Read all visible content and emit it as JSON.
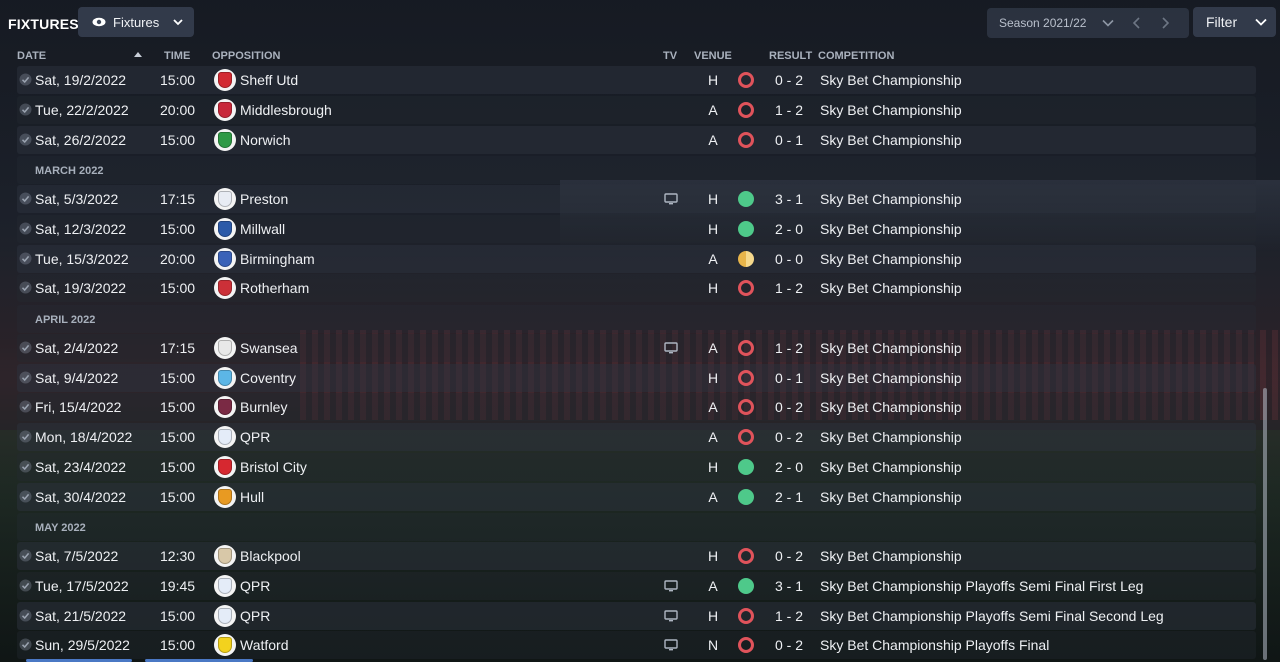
{
  "header": {
    "title": "FIXTURES",
    "view_label": "Fixtures",
    "season_label": "Season 2021/22",
    "filter_label": "Filter"
  },
  "columns": {
    "date": "DATE",
    "time": "TIME",
    "opposition": "OPPOSITION",
    "tv": "TV",
    "venue": "VENUE",
    "result": "RESULT",
    "competition": "COMPETITION"
  },
  "months": [
    "MARCH 2022",
    "APRIL 2022",
    "MAY 2022"
  ],
  "fixtures": [
    {
      "date": "Sat, 19/2/2022",
      "time": "15:00",
      "opponent": "Sheff Utd",
      "crest_color": "#d22a32",
      "tv": false,
      "venue": "H",
      "result": "loss",
      "score": "0 - 2",
      "competition": "Sky Bet Championship"
    },
    {
      "date": "Tue, 22/2/2022",
      "time": "20:00",
      "opponent": "Middlesbrough",
      "crest_color": "#c8283a",
      "tv": false,
      "venue": "A",
      "result": "loss",
      "score": "1 - 2",
      "competition": "Sky Bet Championship"
    },
    {
      "date": "Sat, 26/2/2022",
      "time": "15:00",
      "opponent": "Norwich",
      "crest_color": "#2f9a46",
      "tv": false,
      "venue": "A",
      "result": "loss",
      "score": "0 - 1",
      "competition": "Sky Bet Championship"
    },
    {
      "date": "Sat, 5/3/2022",
      "time": "17:15",
      "opponent": "Preston",
      "crest_color": "#e8ecf4",
      "tv": true,
      "venue": "H",
      "result": "win",
      "score": "3 - 1",
      "competition": "Sky Bet Championship"
    },
    {
      "date": "Sat, 12/3/2022",
      "time": "15:00",
      "opponent": "Millwall",
      "crest_color": "#2c5aa8",
      "tv": false,
      "venue": "H",
      "result": "win",
      "score": "2 - 0",
      "competition": "Sky Bet Championship"
    },
    {
      "date": "Tue, 15/3/2022",
      "time": "20:00",
      "opponent": "Birmingham",
      "crest_color": "#3a62b8",
      "tv": false,
      "venue": "A",
      "result": "draw",
      "score": "0 - 0",
      "competition": "Sky Bet Championship"
    },
    {
      "date": "Sat, 19/3/2022",
      "time": "15:00",
      "opponent": "Rotherham",
      "crest_color": "#cc3038",
      "tv": false,
      "venue": "H",
      "result": "loss",
      "score": "1 - 2",
      "competition": "Sky Bet Championship"
    },
    {
      "date": "Sat, 2/4/2022",
      "time": "17:15",
      "opponent": "Swansea",
      "crest_color": "#e8e8e8",
      "tv": true,
      "venue": "A",
      "result": "loss",
      "score": "1 - 2",
      "competition": "Sky Bet Championship"
    },
    {
      "date": "Sat, 9/4/2022",
      "time": "15:00",
      "opponent": "Coventry",
      "crest_color": "#5cb6e6",
      "tv": false,
      "venue": "H",
      "result": "loss",
      "score": "0 - 1",
      "competition": "Sky Bet Championship"
    },
    {
      "date": "Fri, 15/4/2022",
      "time": "15:00",
      "opponent": "Burnley",
      "crest_color": "#7a2a44",
      "tv": false,
      "venue": "A",
      "result": "loss",
      "score": "0 - 2",
      "competition": "Sky Bet Championship"
    },
    {
      "date": "Mon, 18/4/2022",
      "time": "15:00",
      "opponent": "QPR",
      "crest_color": "#e4ecf8",
      "tv": false,
      "venue": "A",
      "result": "loss",
      "score": "0 - 2",
      "competition": "Sky Bet Championship"
    },
    {
      "date": "Sat, 23/4/2022",
      "time": "15:00",
      "opponent": "Bristol City",
      "crest_color": "#d62830",
      "tv": false,
      "venue": "H",
      "result": "win",
      "score": "2 - 0",
      "competition": "Sky Bet Championship"
    },
    {
      "date": "Sat, 30/4/2022",
      "time": "15:00",
      "opponent": "Hull",
      "crest_color": "#e89a22",
      "tv": false,
      "venue": "A",
      "result": "win",
      "score": "2 - 1",
      "competition": "Sky Bet Championship"
    },
    {
      "date": "Sat, 7/5/2022",
      "time": "12:30",
      "opponent": "Blackpool",
      "crest_color": "#d8c8a8",
      "tv": false,
      "venue": "H",
      "result": "loss",
      "score": "0 - 2",
      "competition": "Sky Bet Championship"
    },
    {
      "date": "Tue, 17/5/2022",
      "time": "19:45",
      "opponent": "QPR",
      "crest_color": "#e4ecf8",
      "tv": true,
      "venue": "A",
      "result": "win",
      "score": "3 - 1",
      "competition": "Sky Bet Championship Playoffs Semi Final First Leg"
    },
    {
      "date": "Sat, 21/5/2022",
      "time": "15:00",
      "opponent": "QPR",
      "crest_color": "#e4ecf8",
      "tv": true,
      "venue": "H",
      "result": "loss",
      "score": "1 - 2",
      "competition": "Sky Bet Championship Playoffs Semi Final Second Leg"
    },
    {
      "date": "Sun, 29/5/2022",
      "time": "15:00",
      "opponent": "Watford",
      "crest_color": "#f2d21e",
      "tv": true,
      "venue": "N",
      "result": "loss",
      "score": "0 - 2",
      "competition": "Sky Bet Championship Playoffs Final"
    }
  ],
  "colors": {
    "loss": "#e0535b",
    "win": "#4ec98a",
    "draw": "#e8b54a"
  }
}
